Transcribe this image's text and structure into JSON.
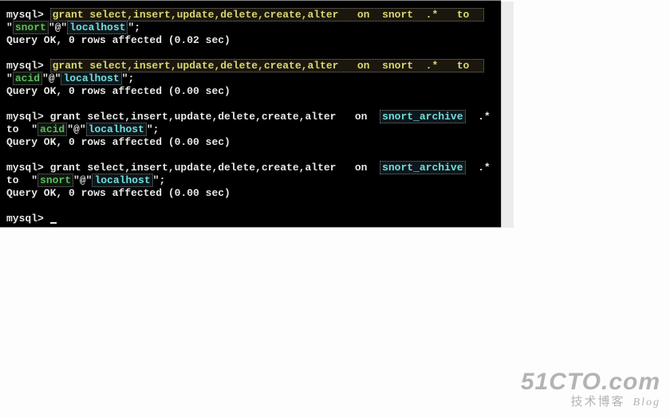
{
  "terminal": {
    "blocks": [
      {
        "type": "cmd",
        "prompt": "mysql>",
        "parts": [
          {
            "cls": "cmd-yellow",
            "text": "grant select,insert,update,delete,create,alter   on  snort  .*   to  "
          },
          {
            "cls": "plain",
            "text": "\""
          },
          {
            "cls": "str-green",
            "text": "snort"
          },
          {
            "cls": "plain",
            "text": "\"@\""
          },
          {
            "cls": "id-cyan",
            "text": "localhost"
          },
          {
            "cls": "plain",
            "text": "\";"
          }
        ],
        "result": "Query OK, 0 rows affected (0.02 sec)"
      },
      {
        "type": "cmd",
        "prompt": "mysql>",
        "parts": [
          {
            "cls": "cmd-yellow",
            "text": "grant select,insert,update,delete,create,alter   on  snort  .*   to  "
          },
          {
            "cls": "plain",
            "text": "\""
          },
          {
            "cls": "str-green",
            "text": "acid"
          },
          {
            "cls": "plain",
            "text": "\"@\""
          },
          {
            "cls": "id-cyan",
            "text": "localhost"
          },
          {
            "cls": "plain",
            "text": "\";"
          }
        ],
        "result": "Query OK, 0 rows affected (0.00 sec)"
      },
      {
        "type": "cmd",
        "prompt": "mysql>",
        "parts": [
          {
            "cls": "plain",
            "text": "grant select,insert,update,delete,create,alter   on  "
          },
          {
            "cls": "id-cyan",
            "text": "snort_archive"
          },
          {
            "cls": "plain",
            "text": "  .*  to  \""
          },
          {
            "cls": "str-green",
            "text": "acid"
          },
          {
            "cls": "plain",
            "text": "\"@\""
          },
          {
            "cls": "id-cyan",
            "text": "localhost"
          },
          {
            "cls": "plain",
            "text": "\";"
          }
        ],
        "result": "Query OK, 0 rows affected (0.00 sec)"
      },
      {
        "type": "cmd",
        "prompt": "mysql>",
        "parts": [
          {
            "cls": "plain",
            "text": "grant select,insert,update,delete,create,alter   on  "
          },
          {
            "cls": "id-cyan",
            "text": "snort_archive"
          },
          {
            "cls": "plain",
            "text": "  .*  to  \""
          },
          {
            "cls": "str-green",
            "text": "snort"
          },
          {
            "cls": "plain",
            "text": "\"@\""
          },
          {
            "cls": "id-cyan",
            "text": "localhost"
          },
          {
            "cls": "plain",
            "text": "\";"
          }
        ],
        "result": "Query OK, 0 rows affected (0.00 sec)"
      },
      {
        "type": "prompt_only",
        "prompt": "mysql>"
      }
    ]
  },
  "watermark": {
    "main": "51CTO.com",
    "sub_cn": "技术博客",
    "sub_en": "Blog"
  }
}
